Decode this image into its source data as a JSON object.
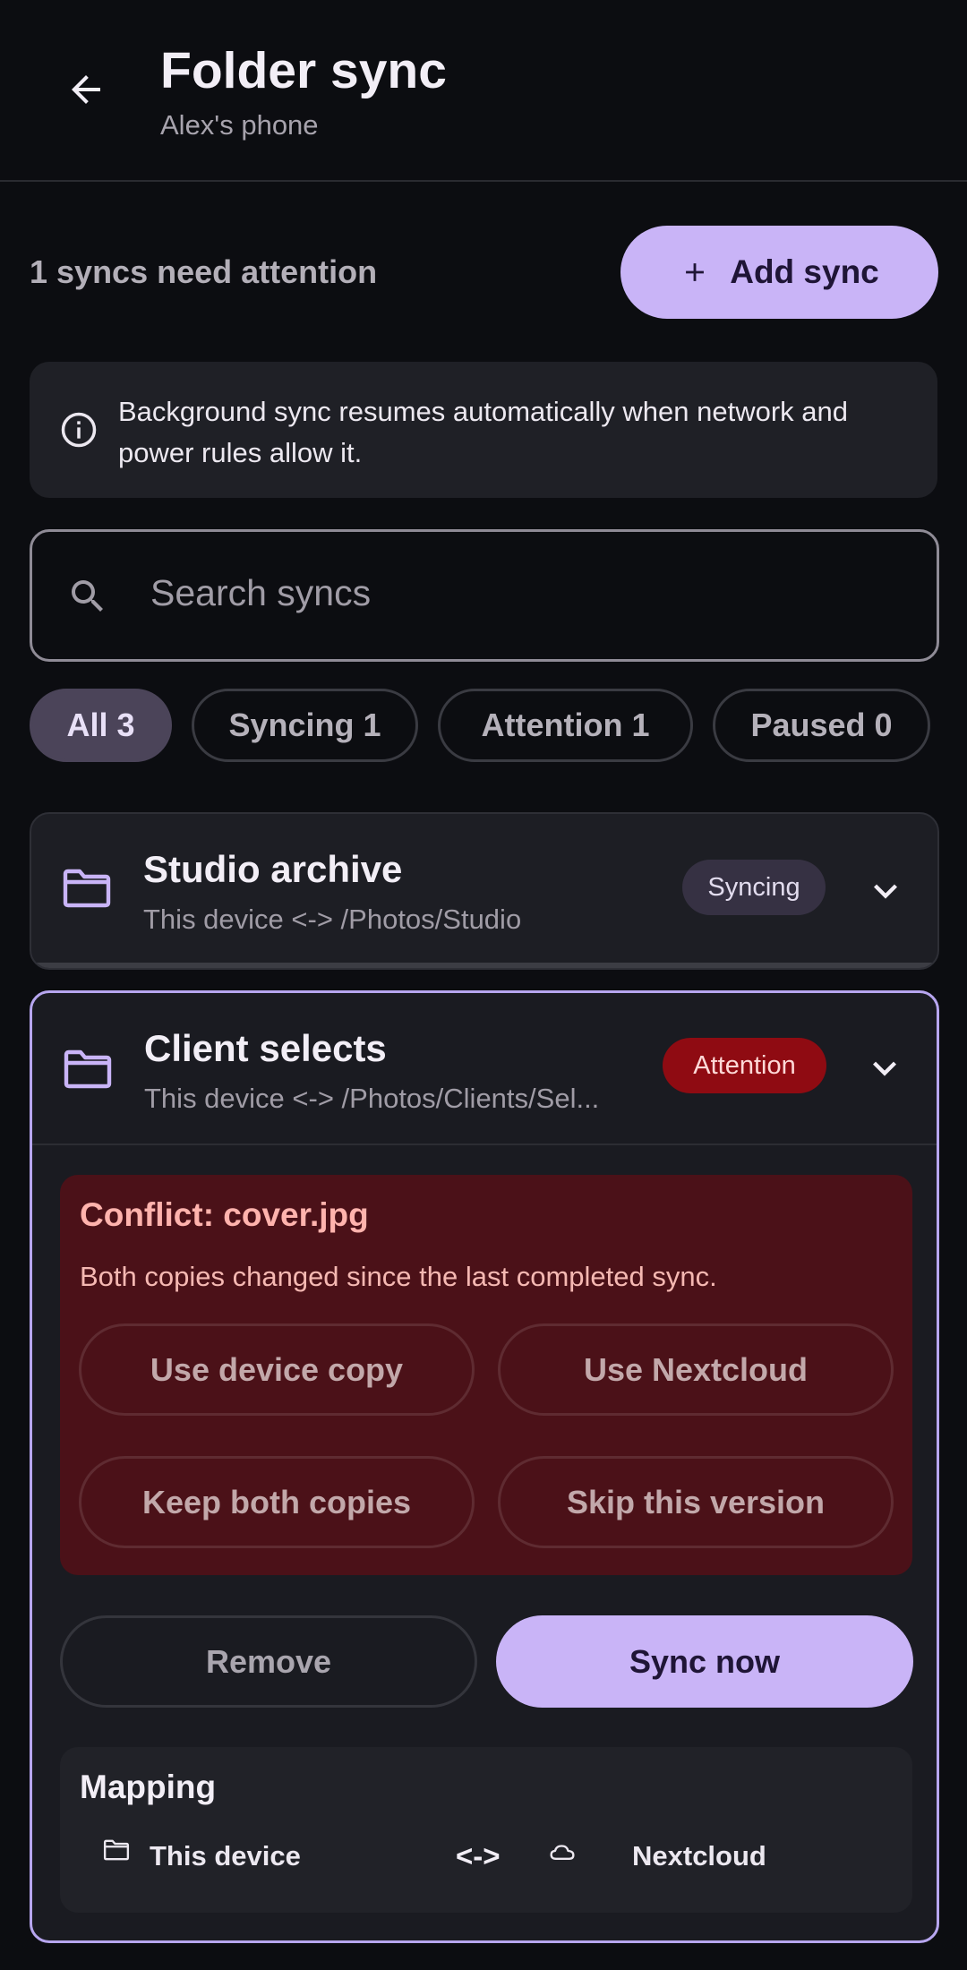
{
  "header": {
    "title": "Folder sync",
    "subtitle": "Alex's phone"
  },
  "summary": {
    "text": "1 syncs need attention",
    "add_label": "Add sync"
  },
  "banner": {
    "text": "Background sync resumes automatically when network and power rules allow it."
  },
  "search": {
    "placeholder": "Search syncs"
  },
  "filters": [
    {
      "label": "All 3",
      "active": true
    },
    {
      "label": "Syncing 1",
      "active": false
    },
    {
      "label": "Attention 1",
      "active": false
    },
    {
      "label": "Paused 0",
      "active": false
    }
  ],
  "syncs": [
    {
      "name": "Studio archive",
      "path": "This device <-> /Photos/Studio",
      "status": "Syncing"
    },
    {
      "name": "Client selects",
      "path": "This device <-> /Photos/Clients/Sel...",
      "status": "Attention"
    }
  ],
  "conflict": {
    "title": "Conflict: cover.jpg",
    "description": "Both copies changed since the last completed sync.",
    "options": [
      "Use device copy",
      "Use Nextcloud",
      "Keep both copies",
      "Skip this version"
    ]
  },
  "actions": {
    "remove": "Remove",
    "sync_now": "Sync now"
  },
  "mapping": {
    "title": "Mapping",
    "local": "This device",
    "arrow": "<->",
    "remote": "Nextcloud"
  },
  "colors": {
    "accent": "#c9b4f7",
    "attention": "#8f0b12",
    "conflict_bg": "#4b1118",
    "background": "#0c0d11"
  }
}
